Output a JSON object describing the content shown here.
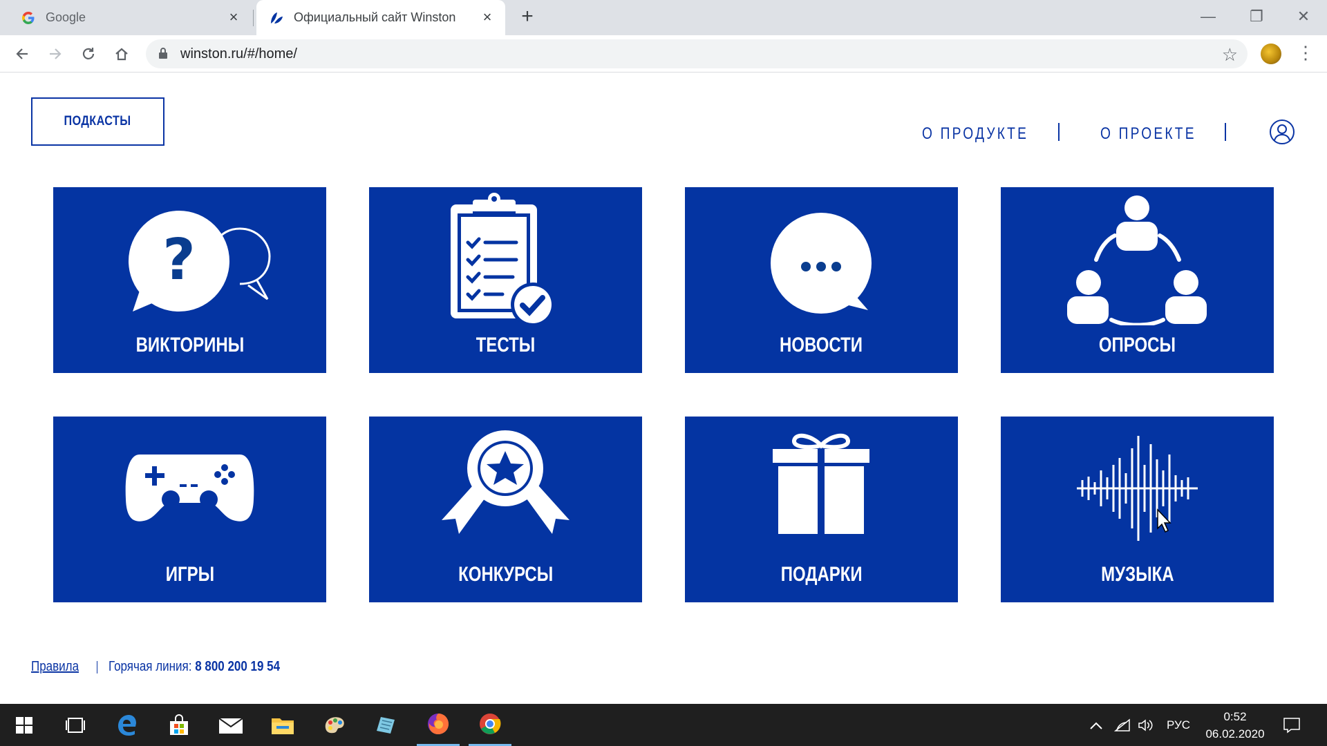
{
  "browser": {
    "tabs": [
      {
        "title": "Google",
        "active": false
      },
      {
        "title": "Официальный сайт Winston",
        "active": true
      }
    ],
    "url": "winston.ru/#/home/"
  },
  "site": {
    "podcasts_label": "ПОДКАСТЫ",
    "nav": [
      {
        "label": "О ПРОДУКТЕ"
      },
      {
        "label": "О ПРОЕКТЕ"
      }
    ],
    "tiles": [
      {
        "label": "ВИКТОРИНЫ",
        "icon": "quiz-icon"
      },
      {
        "label": "ТЕСТЫ",
        "icon": "clipboard-check-icon"
      },
      {
        "label": "НОВОСТИ",
        "icon": "chat-bubble-icon"
      },
      {
        "label": "ОПРОСЫ",
        "icon": "people-cycle-icon"
      },
      {
        "label": "ИГРЫ",
        "icon": "gamepad-icon"
      },
      {
        "label": "КОНКУРСЫ",
        "icon": "award-icon"
      },
      {
        "label": "ПОДАРКИ",
        "icon": "gift-icon"
      },
      {
        "label": "МУЗЫКА",
        "icon": "sound-wave-icon"
      }
    ],
    "footer": {
      "rules": "Правила",
      "hotline_label": "Горячая линия:",
      "hotline_number": "8 800 200 19 54"
    },
    "colors": {
      "brand": "#0434a2"
    }
  },
  "taskbar": {
    "lang": "РУС",
    "time": "0:52",
    "date": "06.02.2020"
  }
}
